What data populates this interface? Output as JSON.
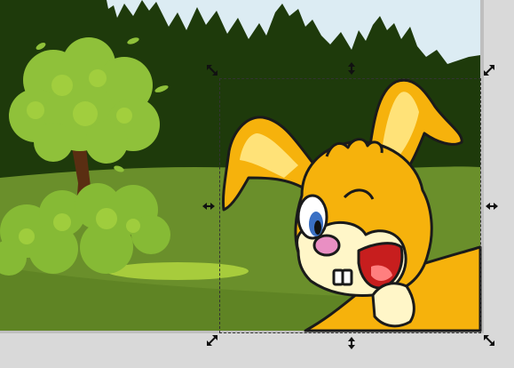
{
  "canvas": {
    "background_color": "#d9d9d9",
    "sky_color": "#dcecf3",
    "forest_color": "#1f3a0c",
    "meadow_color": "#6a8f2a",
    "bush_color": "#8fc13a"
  },
  "selection": {
    "handles": [
      {
        "name": "top-left",
        "icon": "diagonal-scale-arrow-icon"
      },
      {
        "name": "top-center",
        "icon": "vertical-scale-arrow-icon"
      },
      {
        "name": "top-right",
        "icon": "diagonal-scale-arrow-icon"
      },
      {
        "name": "middle-left",
        "icon": "horizontal-scale-arrow-icon"
      },
      {
        "name": "middle-right",
        "icon": "horizontal-scale-arrow-icon"
      },
      {
        "name": "bottom-left",
        "icon": "diagonal-scale-arrow-icon"
      },
      {
        "name": "bottom-center",
        "icon": "vertical-scale-arrow-icon"
      },
      {
        "name": "bottom-right",
        "icon": "diagonal-scale-arrow-icon"
      }
    ]
  }
}
